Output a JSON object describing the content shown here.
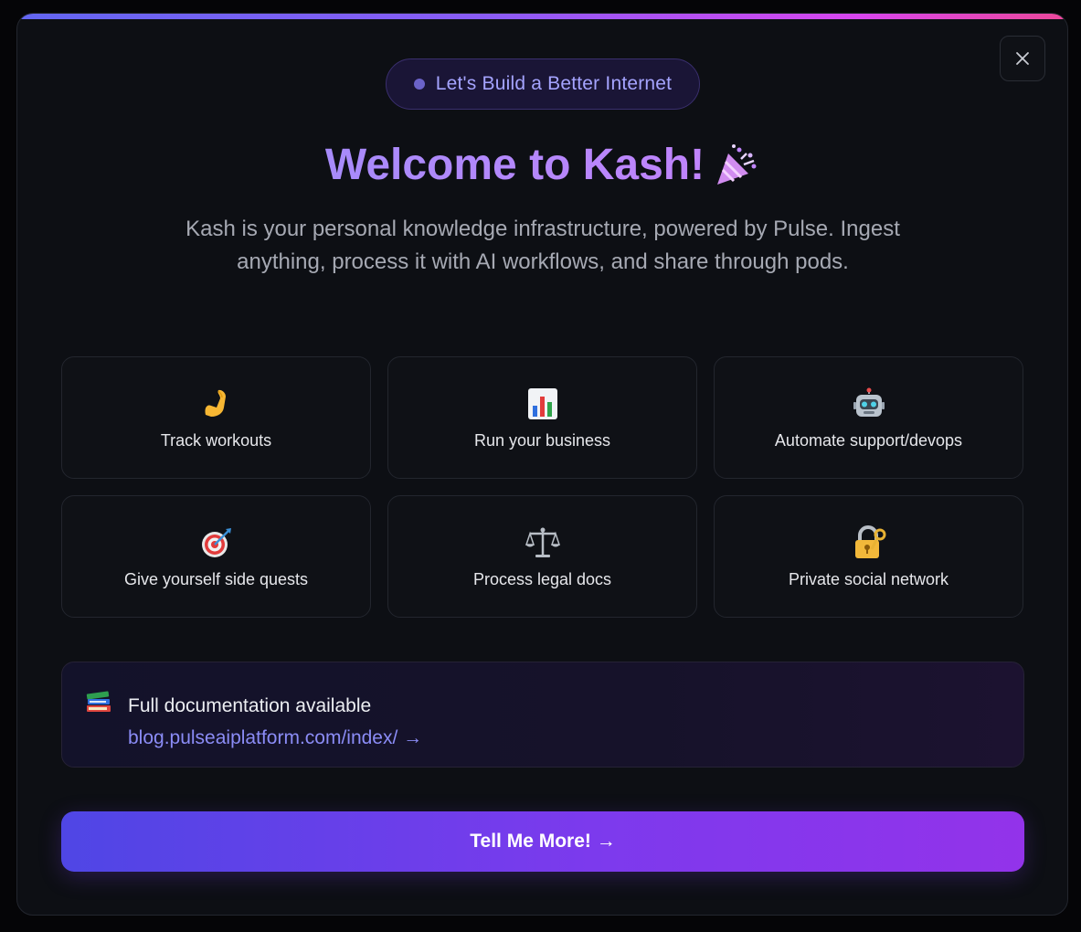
{
  "badge": {
    "text": "Let's Build a Better Internet"
  },
  "header": {
    "title": "Welcome to Kash!",
    "title_icon": "party-popper-icon"
  },
  "subtitle": "Kash is your personal knowledge infrastructure, powered by Pulse. Ingest anything, process it with AI workflows, and share through pods.",
  "use_cases": [
    {
      "icon": "flexed-biceps-icon",
      "label": "Track workouts"
    },
    {
      "icon": "bar-chart-icon",
      "label": "Run your business"
    },
    {
      "icon": "robot-icon",
      "label": "Automate support/devops"
    },
    {
      "icon": "target-icon",
      "label": "Give yourself side quests"
    },
    {
      "icon": "scales-icon",
      "label": "Process legal docs"
    },
    {
      "icon": "lock-key-icon",
      "label": "Private social network"
    }
  ],
  "docs": {
    "icon": "books-icon",
    "title": "Full documentation available",
    "link": "blog.pulseaiplatform.com/index/ →"
  },
  "cta": {
    "label": "Tell Me More! →"
  },
  "close": {
    "icon": "close-icon"
  },
  "colors": {
    "accent_start": "#4f46e5",
    "accent_end": "#9333ea",
    "title_gradient": "#a78bfa",
    "link": "#8b8cf6"
  }
}
